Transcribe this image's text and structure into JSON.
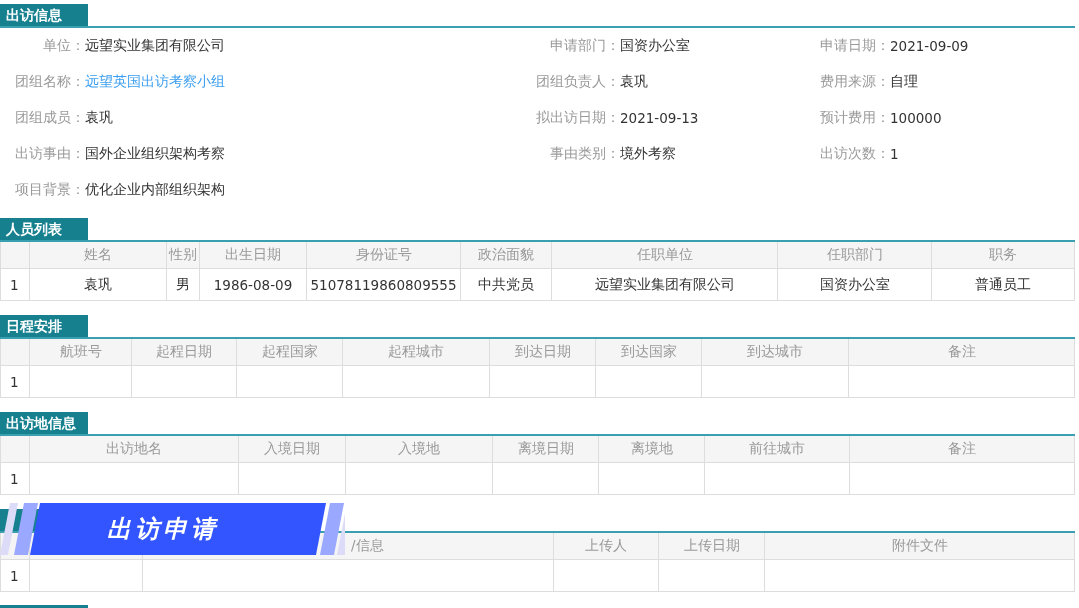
{
  "sections": [
    {
      "kind": "form",
      "title": "出访信息",
      "rows": [
        [
          {
            "label": "单位：",
            "value": "远望实业集团有限公司"
          },
          {
            "label": "申请部门：",
            "value": "国资办公室"
          },
          {
            "label": "申请日期：",
            "value": "2021-09-09"
          }
        ],
        [
          {
            "label": "团组名称：",
            "value": "远望英国出访考察小组",
            "link": true
          },
          {
            "label": "团组负责人：",
            "value": "袁巩"
          },
          {
            "label": "费用来源：",
            "value": "自理"
          }
        ],
        [
          {
            "label": "团组成员：",
            "value": "袁巩"
          },
          {
            "label": "拟出访日期：",
            "value": "2021-09-13"
          },
          {
            "label": "预计费用：",
            "value": "100000"
          }
        ],
        [
          {
            "label": "出访事由：",
            "value": "国外企业组织架构考察"
          },
          {
            "label": "事由类别：",
            "value": "境外考察"
          },
          {
            "label": "出访次数：",
            "value": "1"
          }
        ],
        [
          {
            "label": "项目背景：",
            "value": "优化企业内部组织架构"
          }
        ]
      ]
    },
    {
      "kind": "table",
      "title": "人员列表",
      "columns": [
        {
          "label": "姓名"
        },
        {
          "label": "性别"
        },
        {
          "label": "出生日期"
        },
        {
          "label": "身份证号"
        },
        {
          "label": "政治面貌"
        },
        {
          "label": "任职单位"
        },
        {
          "label": "任职部门"
        },
        {
          "label": "职务"
        }
      ],
      "rows": [
        {
          "number": "1",
          "cells": [
            "袁巩",
            "男",
            "1986-08-09",
            "51078119860809555",
            "中共党员",
            "远望实业集团有限公司",
            "国资办公室",
            "普通员工"
          ]
        }
      ]
    },
    {
      "kind": "table",
      "title": "日程安排",
      "columns": [
        {
          "label": "航班号"
        },
        {
          "label": "起程日期"
        },
        {
          "label": "起程国家"
        },
        {
          "label": "起程城市"
        },
        {
          "label": "到达日期"
        },
        {
          "label": "到达国家"
        },
        {
          "label": "到达城市"
        },
        {
          "label": "备注"
        }
      ],
      "rows": [
        {
          "number": "1"
        }
      ]
    },
    {
      "kind": "table",
      "title": "出访地信息",
      "columns": [
        {
          "label": "出访地名"
        },
        {
          "label": "入境日期"
        },
        {
          "label": "入境地"
        },
        {
          "label": "离境日期"
        },
        {
          "label": "离境地"
        },
        {
          "label": "前往城市"
        },
        {
          "label": "备注"
        }
      ],
      "rows": [
        {
          "number": "1"
        }
      ]
    },
    {
      "kind": "table",
      "columns": [
        {},
        {
          "label": "/信息"
        },
        {
          "label": "上传人"
        },
        {
          "label": "上传日期"
        },
        {
          "label": "附件文件"
        }
      ],
      "rows": [
        {
          "number": "1"
        }
      ]
    },
    {
      "kind": "header"
    }
  ],
  "banner": {
    "text": "出访申请"
  }
}
